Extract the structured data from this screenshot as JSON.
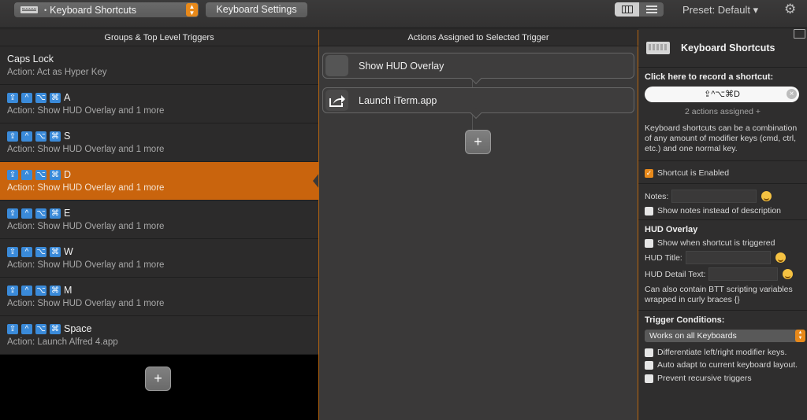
{
  "toolbar": {
    "trigger_type_select": "Keyboard Shortcuts",
    "keyboard_settings_label": "Keyboard Settings",
    "preset_label": "Preset: Default ▾"
  },
  "left": {
    "header": "Groups & Top Level Triggers",
    "add_label": "+",
    "triggers": [
      {
        "title": "Caps Lock",
        "action": "Action: Act as Hyper Key"
      },
      {
        "key": "A",
        "action": "Action: Show HUD Overlay and 1 more"
      },
      {
        "key": "S",
        "action": "Action: Show HUD Overlay and 1 more"
      },
      {
        "key": "D",
        "action": "Action: Show HUD Overlay and 1 more"
      },
      {
        "key": "E",
        "action": "Action: Show HUD Overlay and 1 more"
      },
      {
        "key": "W",
        "action": "Action: Show HUD Overlay and 1 more"
      },
      {
        "key": "M",
        "action": "Action: Show HUD Overlay and 1 more"
      },
      {
        "key": "Space",
        "action": "Action: Launch Alfred 4.app"
      }
    ],
    "modifier_glyphs": [
      "⇪",
      "^",
      "⌥",
      "⌘"
    ]
  },
  "middle": {
    "header": "Actions Assigned to Selected Trigger",
    "actions": [
      {
        "label": "Show HUD Overlay"
      },
      {
        "label": "Launch iTerm.app"
      }
    ],
    "add_label": "+"
  },
  "right": {
    "title": "Keyboard Shortcuts",
    "record_label": "Click here to record a shortcut:",
    "shortcut_value": "⇪^⌥⌘D",
    "assigned_text": "2 actions assigned +",
    "description": "Keyboard shortcuts can be a combination of any amount of modifier keys (cmd, ctrl, etc.) and one normal key.",
    "enabled_label": "Shortcut is Enabled",
    "notes_label": "Notes:",
    "show_notes_label": "Show notes instead of description",
    "hud_header": "HUD Overlay",
    "hud_show_label": "Show when shortcut is triggered",
    "hud_title_label": "HUD Title:",
    "hud_detail_label": "HUD Detail Text:",
    "hud_vars_text": "Can also contain BTT scripting variables wrapped in curly braces {}",
    "conditions_header": "Trigger Conditions:",
    "keyboards_select": "Works on all Keyboards",
    "diff_modifiers_label": "Differentiate left/right modifier keys.",
    "auto_adapt_label": "Auto adapt to current keyboard layout.",
    "prevent_recursive_label": "Prevent recursive triggers"
  },
  "colors": {
    "accent": "#c9640d",
    "modifier_blue": "#3a8ad9"
  }
}
